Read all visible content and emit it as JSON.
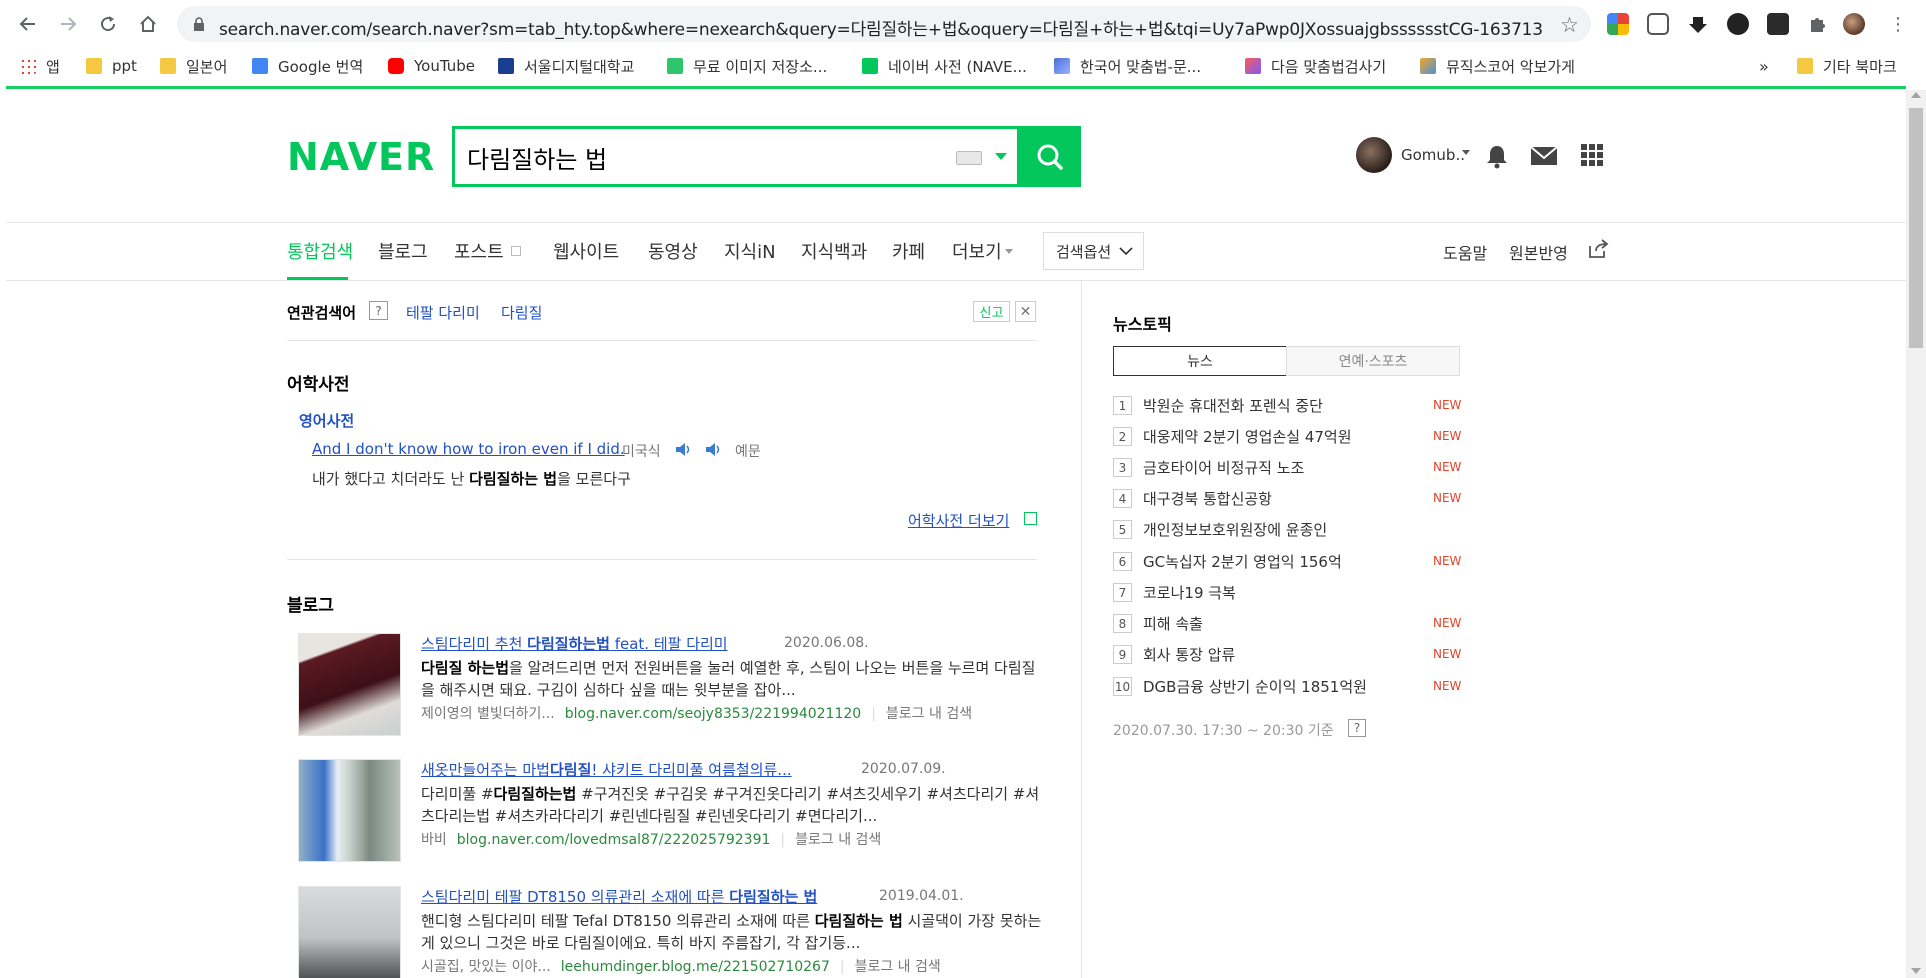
{
  "browser": {
    "url": "search.naver.com/search.naver?sm=tab_hty.top&where=nexearch&query=다림질하는+법&oquery=다림질+하는+법&tqi=Uy7aPwp0JXossuajgbsssssstCG-163713",
    "bookmarks": [
      {
        "label": "앱",
        "icon": "apps-grid-icon"
      },
      {
        "label": "ppt",
        "icon": "folder-icon"
      },
      {
        "label": "일본어",
        "icon": "folder-icon"
      },
      {
        "label": "Google 번역",
        "icon": "google-translate-icon"
      },
      {
        "label": "YouTube",
        "icon": "youtube-icon"
      },
      {
        "label": "서울디지털대학교",
        "icon": "sdu-icon"
      },
      {
        "label": "무료 이미지 저장소...",
        "icon": "pixabay-icon"
      },
      {
        "label": "네이버 사전 (NAVE...",
        "icon": "naver-dict-icon"
      },
      {
        "label": "한국어 맞춤법-문...",
        "icon": "spell-icon"
      },
      {
        "label": "다음 맞춤법검사기",
        "icon": "daum-icon"
      },
      {
        "label": "뮤직스코어 악보가게",
        "icon": "music-icon"
      }
    ],
    "bookmarks_overflow": "»",
    "other_bookmarks": "기타 북마크"
  },
  "header": {
    "logo": "NAVER",
    "search_value": "다림질하는 법",
    "user_name": "Gomub.."
  },
  "tabs": [
    {
      "label": "통합검색",
      "active": true
    },
    {
      "label": "블로그"
    },
    {
      "label": "포스트"
    },
    {
      "label": "웹사이트"
    },
    {
      "label": "동영상"
    },
    {
      "label": "지식iN"
    },
    {
      "label": "지식백과"
    },
    {
      "label": "카페"
    },
    {
      "label": "더보기"
    }
  ],
  "search_option": "검색옵션",
  "right_links": {
    "help": "도움말",
    "original": "원본반영"
  },
  "related": {
    "label": "연관검색어",
    "help": "?",
    "keywords": [
      "테팔 다리미",
      "다림질"
    ],
    "report": "신고"
  },
  "dictionary": {
    "title": "어학사전",
    "subtitle": "영어사전",
    "sentence_en": "And I don't know how to iron even if I did.",
    "accent": "미국식",
    "example": "예문",
    "sentence_kr_before": "내가 했다고 치더라도 난 ",
    "sentence_kr_bold": "다림질하는 법",
    "sentence_kr_after": "을 모른다구",
    "more": "어학사전 더보기"
  },
  "blog": {
    "title": "블로그",
    "items": [
      {
        "title_pre": "스팀다리미 추천 ",
        "title_bold": "다림질하는법",
        "title_post": " feat. 테팔 다리미",
        "date": "2020.06.08.",
        "desc_bold": "다림질 하는법",
        "desc": "을 알려드리면 먼저 전원버튼을 눌러 예열한 후, 스팀이 나오는 버튼을 누르며 다림질을 해주시면 돼요. 구김이 심하다 싶을 때는 윗부분을 잡아...",
        "author": "제이영의 별빛더하기...",
        "url": "blog.naver.com/seojy8353/221994021120",
        "inblog": "블로그 내 검색"
      },
      {
        "title_pre": "새옷만들어주는 마법",
        "title_bold": "다림질",
        "title_post": "! 샤키트 다리미풀 여름철의류...",
        "date": "2020.07.09.",
        "desc_pre": "다리미풀 #",
        "desc_bold": "다림질하는법",
        "desc": " #구겨진옷 #구김옷 #구겨진옷다리기 #셔츠깃세우기 #셔츠다리기 #셔츠다리는법 #셔츠카라다리기 #린넨다림질 #린넨옷다리기 #면다리기...",
        "author": "바비",
        "url": "blog.naver.com/lovedmsal87/222025792391",
        "inblog": "블로그 내 검색"
      },
      {
        "title_pre": "스팀다리미 테팔 DT8150 의류관리 소재에 따른 ",
        "title_bold": "다림질하는 법",
        "title_post": "",
        "date": "2019.04.01.",
        "desc_pre": "핸디형 스팀다리미 테팔 Tefal DT8150 의류관리 소재에 따른 ",
        "desc_bold": "다림질하는 법",
        "desc": " 시골댁이 가장 못하는 게 있으니 그것은 바로 다림질이에요. 특히 바지 주름잡기, 각 잡기등...",
        "author": "시골집, 맛있는 이야...",
        "url": "leehumdinger.blog.me/221502710267",
        "inblog": "블로그 내 검색"
      }
    ]
  },
  "news": {
    "title": "뉴스토픽",
    "tabs": [
      "뉴스",
      "연예·스포츠"
    ],
    "items": [
      {
        "num": "1",
        "text": "박원순 휴대전화 포렌식 중단",
        "new": "NEW"
      },
      {
        "num": "2",
        "text": "대웅제약 2분기 영업손실 47억원",
        "new": "NEW"
      },
      {
        "num": "3",
        "text": "금호타이어 비정규직 노조",
        "new": "NEW"
      },
      {
        "num": "4",
        "text": "대구경북 통합신공항",
        "new": "NEW"
      },
      {
        "num": "5",
        "text": "개인정보보호위원장에 윤종인",
        "new": ""
      },
      {
        "num": "6",
        "text": "GC녹십자 2분기 영업익 156억",
        "new": "NEW"
      },
      {
        "num": "7",
        "text": "코로나19 극복",
        "new": ""
      },
      {
        "num": "8",
        "text": "피해 속출",
        "new": "NEW"
      },
      {
        "num": "9",
        "text": "회사 통장 압류",
        "new": "NEW"
      },
      {
        "num": "10",
        "text": "DGB금융 상반기 순이익 1851억원",
        "new": "NEW"
      }
    ],
    "time": "2020.07.30. 17:30 ~ 20:30 기준",
    "time_help": "?"
  },
  "colors": {
    "naver_green": "#03c75a",
    "link_blue": "#2251c4",
    "url_green": "#2a8a3c",
    "new_red": "#e0442b"
  }
}
